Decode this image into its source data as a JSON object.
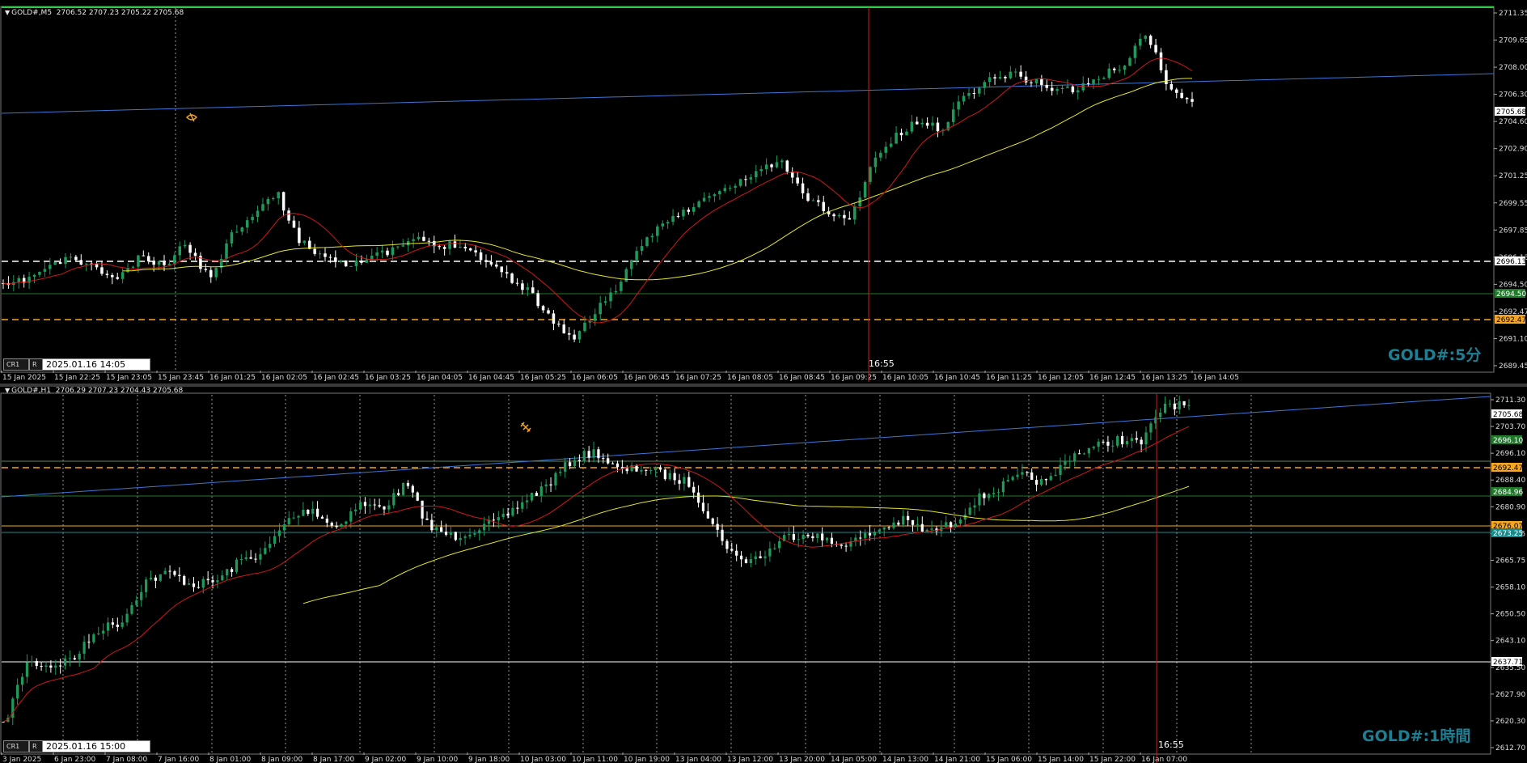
{
  "charts": [
    {
      "info": "GOLD#,M5  2706.52 2707.23 2705.22 2705.68",
      "watermark": "GOLD#:5分",
      "tag_label": "CR1",
      "tag_r": "R",
      "datetime": "2025.01.16 14:05",
      "cursor_time": "16:55",
      "y_ticks": [
        "2711.35",
        "2709.65",
        "2708.00",
        "2706.30",
        "2704.60",
        "2702.90",
        "2701.25",
        "2699.55",
        "2697.85",
        "2696.13",
        "2694.50",
        "2692.47",
        "2691.10",
        "2689.45"
      ],
      "x_labels": [
        "15 Jan 2025",
        "15 Jan 22:25",
        "15 Jan 23:05",
        "15 Jan 23:45",
        "16 Jan 01:25",
        "16 Jan 02:05",
        "16 Jan 02:45",
        "16 Jan 03:25",
        "16 Jan 04:05",
        "16 Jan 04:45",
        "16 Jan 05:25",
        "16 Jan 06:05",
        "16 Jan 06:45",
        "16 Jan 07:25",
        "16 Jan 08:05",
        "16 Jan 08:45",
        "16 Jan 09:25",
        "16 Jan 10:05",
        "16 Jan 10:45",
        "16 Jan 11:25",
        "16 Jan 12:05",
        "16 Jan 12:45",
        "16 Jan 13:25",
        "16 Jan 14:05"
      ],
      "price_labels": [
        {
          "text": "2705.68",
          "bg": "#ffffff",
          "fg": "#000000"
        },
        {
          "text": "2696.13",
          "bg": "#ffffff",
          "fg": "#000000"
        },
        {
          "text": "2694.50",
          "bg": "#1f7a2a",
          "fg": "#ffffff"
        },
        {
          "text": "2692.47",
          "bg": "#f5a623",
          "fg": "#000000"
        }
      ]
    },
    {
      "info": "GOLD#,H1  2706.29 2707.23 2704.43 2705.68",
      "watermark": "GOLD#:1時間",
      "tag_label": "CR1",
      "tag_r": "R",
      "datetime": "2025.01.16 15:00",
      "cursor_time": "16:55",
      "y_ticks": [
        "2711.30",
        "2703.70",
        "2696.10",
        "2688.40",
        "2680.90",
        "2673.25",
        "2665.75",
        "2658.10",
        "2650.50",
        "2643.10",
        "2635.50",
        "2627.90",
        "2620.30",
        "2612.70"
      ],
      "x_labels": [
        "3 Jan 2025",
        "6 Jan 23:00",
        "7 Jan 08:00",
        "7 Jan 16:00",
        "8 Jan 01:00",
        "8 Jan 09:00",
        "8 Jan 17:00",
        "9 Jan 02:00",
        "9 Jan 10:00",
        "9 Jan 18:00",
        "10 Jan 03:00",
        "10 Jan 11:00",
        "10 Jan 19:00",
        "13 Jan 04:00",
        "13 Jan 12:00",
        "13 Jan 20:00",
        "14 Jan 05:00",
        "14 Jan 13:00",
        "14 Jan 21:00",
        "15 Jan 06:00",
        "15 Jan 14:00",
        "15 Jan 22:00",
        "16 Jan 07:00"
      ],
      "price_labels": [
        {
          "text": "2705.68",
          "bg": "#ffffff",
          "fg": "#000000"
        },
        {
          "text": "2696.10",
          "bg": "#1f7a2a",
          "fg": "#ffffff"
        },
        {
          "text": "2692.47",
          "bg": "#f5a623",
          "fg": "#000000"
        },
        {
          "text": "2684.96",
          "bg": "#1f7a2a",
          "fg": "#ffffff"
        },
        {
          "text": "2676.07",
          "bg": "#f5a623",
          "fg": "#000000"
        },
        {
          "text": "2673.25",
          "bg": "#1b8a8a",
          "fg": "#ffffff"
        },
        {
          "text": "2637.71",
          "bg": "#ffffff",
          "fg": "#000000"
        }
      ]
    }
  ],
  "colors": {
    "bull": "#1f9a5a",
    "bear": "#ffffff",
    "ma_fast": "#d01818",
    "ma_slow": "#e6e62a",
    "trendline": "#3b78d8",
    "cursor": "#d01818",
    "hline_green": "#1f7a2a",
    "hline_orange": "#f5a623",
    "hline_teal": "#1b8a8a",
    "grid": "#5a5a5a",
    "top_bar": "#2ecc40"
  },
  "icons": {
    "pane1_marker": "eye-icon",
    "pane2_marker": "satellite-icon"
  }
}
